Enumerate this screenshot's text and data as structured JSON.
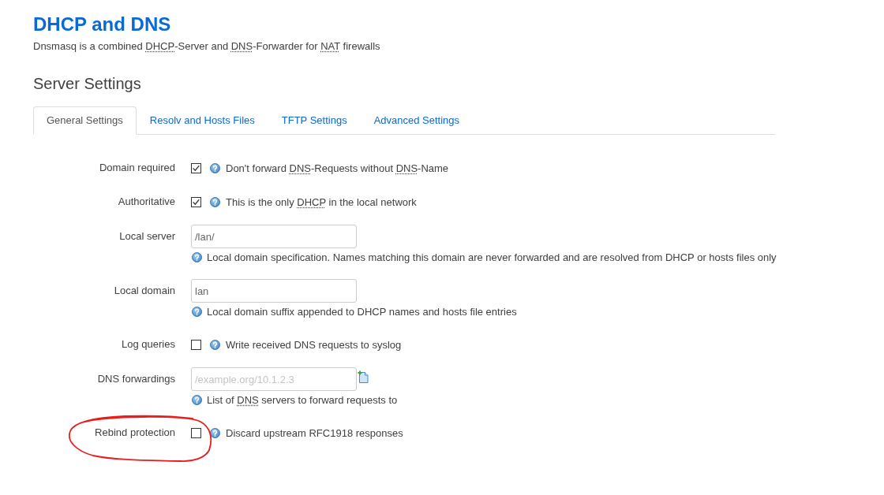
{
  "page": {
    "title": "DHCP and DNS",
    "description": [
      {
        "text": "Dnsmasq is a combined ",
        "abbr": false
      },
      {
        "text": "DHCP",
        "abbr": true
      },
      {
        "text": "-Server and ",
        "abbr": false
      },
      {
        "text": "DNS",
        "abbr": true
      },
      {
        "text": "-Forwarder for ",
        "abbr": false
      },
      {
        "text": "NAT",
        "abbr": true
      },
      {
        "text": " firewalls",
        "abbr": false
      }
    ]
  },
  "section": {
    "title": "Server Settings",
    "tabs": [
      {
        "label": "General Settings",
        "selected": true
      },
      {
        "label": "Resolv and Hosts Files",
        "selected": false
      },
      {
        "label": "TFTP Settings",
        "selected": false
      },
      {
        "label": "Advanced Settings",
        "selected": false
      }
    ],
    "rows": [
      {
        "kind": "checkbox",
        "label": "Domain required",
        "checked": true,
        "highlighted": false,
        "help": [
          {
            "text": "Don't forward ",
            "abbr": false
          },
          {
            "text": "DNS",
            "abbr": true
          },
          {
            "text": "-Requests without ",
            "abbr": false
          },
          {
            "text": "DNS",
            "abbr": true
          },
          {
            "text": "-Name",
            "abbr": false
          }
        ]
      },
      {
        "kind": "checkbox",
        "label": "Authoritative",
        "checked": true,
        "highlighted": false,
        "help": [
          {
            "text": "This is the only ",
            "abbr": false
          },
          {
            "text": "DHCP",
            "abbr": true
          },
          {
            "text": " in the local network",
            "abbr": false
          }
        ]
      },
      {
        "kind": "text",
        "label": "Local server",
        "value": "/lan/",
        "highlighted": false,
        "help": [
          {
            "text": "Local domain specification. Names matching this domain are never forwarded and are resolved from DHCP or hosts files only",
            "abbr": false
          }
        ]
      },
      {
        "kind": "text",
        "label": "Local domain",
        "value": "lan",
        "highlighted": false,
        "help": [
          {
            "text": "Local domain suffix appended to DHCP names and hosts file entries",
            "abbr": false
          }
        ]
      },
      {
        "kind": "checkbox",
        "label": "Log queries",
        "checked": false,
        "highlighted": false,
        "help": [
          {
            "text": "Write received DNS requests to syslog",
            "abbr": false
          }
        ]
      },
      {
        "kind": "dynlist",
        "label": "DNS forwardings",
        "placeholder": "/example.org/10.1.2.3",
        "highlighted": false,
        "help": [
          {
            "text": "List of ",
            "abbr": false
          },
          {
            "text": "DNS",
            "abbr": true
          },
          {
            "text": " servers to forward requests to",
            "abbr": false
          }
        ]
      },
      {
        "kind": "checkbox",
        "label": "Rebind protection",
        "checked": false,
        "highlighted": true,
        "help": [
          {
            "text": "Discard upstream RFC1918 responses",
            "abbr": false
          }
        ]
      }
    ]
  }
}
